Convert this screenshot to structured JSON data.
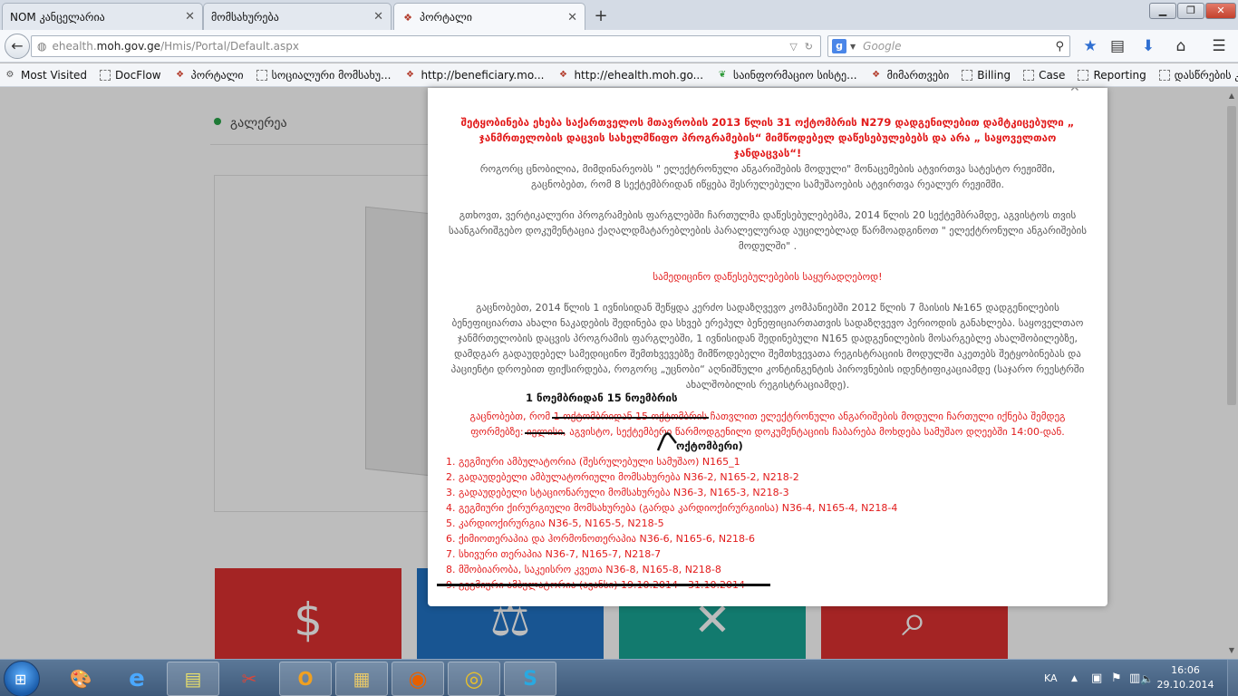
{
  "browser": {
    "tabs": [
      {
        "label": "NOM კანცელარია",
        "close": "✕"
      },
      {
        "label": "მომსახურება",
        "close": "✕"
      },
      {
        "label": "პორტალი",
        "close": "✕"
      }
    ],
    "new_tab": "+",
    "window_controls": {
      "minimize": "▁",
      "restore": "❐",
      "close": "✕"
    },
    "back_icon": "←",
    "url_prefix": "ehealth.",
    "url_domain": "moh.gov.ge",
    "url_path": "/Hmis/Portal/Default.aspx",
    "search_engine": "g",
    "search_placeholder": "Google",
    "bookmarks": [
      {
        "label": "Most Visited",
        "icon": "gear"
      },
      {
        "label": "DocFlow",
        "icon": "box"
      },
      {
        "label": "პორტალი",
        "icon": "crest"
      },
      {
        "label": "სოციალური მომსახუ...",
        "icon": "box"
      },
      {
        "label": "http://beneficiary.mo...",
        "icon": "crest"
      },
      {
        "label": "http://ehealth.moh.go...",
        "icon": "crest"
      },
      {
        "label": "საინფორმაციო სისტე...",
        "icon": "leaf"
      },
      {
        "label": "მიმართვები",
        "icon": "crest"
      },
      {
        "label": "Billing",
        "icon": "box"
      },
      {
        "label": "Case",
        "icon": "box"
      },
      {
        "label": "Reporting",
        "icon": "box"
      },
      {
        "label": "დასწრების კონტრო...",
        "icon": "box"
      }
    ]
  },
  "page": {
    "section_title": "გალერეა"
  },
  "modal": {
    "close": "✕",
    "title_line1": "შეტყობინება ეხება საქართველოს მთავრობის 2013 წლის 31 ოქტომბრის N279 დადგენილებით დამტკიცებული „",
    "title_line2": "ჯანმრთელობის დაცვის სახელმწიფო პროგრამების“ მიმწოდებელ დაწესებულებებს და არა „ საყოველთაო ჯანდაცვას“!",
    "para1": "როგორც ცნობილია, მიმდინარეობს \" ელექტრონული ანგარიშების მოდული\" მონაცემების ატვირთვა სატესტო რეჟიმში, გაცნობებთ, რომ 8 სექტემბრიდან იწყება შესრულებული სამუშაოების ატვირთვა რეალურ რეჟიმში.",
    "para2": "გთხოვთ, ვერტიკალური პროგრამების ფარგლებში ჩართულმა დაწესებულებებმა, 2014 წლის 20 სექტემბრამდე, აგვისტოს თვის საანგარიშგებო დოკუმენტაცია ქაღალდმატარებლების პარალელურად აუცილებლად წარმოადგინოთ \" ელექტრონული ანგარიშების მოდულში\" .",
    "notice": "სამედიცინო დაწესებულებების საყურადღებოდ!",
    "para3": "გაცნობებთ, 2014 წლის 1 ივნისიდან შეწყდა კერძო სადაზღვევო კომპანიებში 2012 წლის 7 მაისის №165 დადგენილების ბენეფიციართა ახალი ნაკადების შედინება და სხვებ ერეპულ ბენეფიციართათვის სადაზღვევო პერიოდის განახლება. საყოველთაო ჯანმრთელობის დაცვის პროგრამის ფარგლებში, 1 ივნისიდან შედინებული N165 დადგენილების მოსარგებლე ახალშობილებზე, დამდგარ გადაუდებელ სამედიცინო შემთხვევებზე მიმწოდებელი შემთხვევათა რეგისტრაციის მოდულში აკეთებს შეტყობინებას და პაციენტი დროებით ფიქსირდება, როგორც „უცნობი“ აღნიშნული კონტინგენტის პიროვნების იდენტიფიკაციამდე (საჯარო რეესტრში ახალშობილის რეგისტრაციამდე).",
    "handwritten_top": "1 ნოემბრიდან 15 ნოემბრის",
    "red_part1": "გაცნობებთ, რომ ",
    "red_struck1": "1 ოქტომბრიდან 15 ოქტომბრის",
    "red_part2": " ჩათვლით ელექტრონული ანგარიშების მოდული ჩართული იქნება შემდეგ ფორმებზე: ",
    "red_struck2": "ივლისი",
    "red_part3": ", აგვისტო, სექტემბერი წარმოდგენილი დოკუმენტაციის ჩაბარება მოხდება სამუშაო დღეებში 14:00-დან.",
    "handwritten_bottom": "ოქტომბერი)",
    "list": [
      "1. გეგმიური ამბულატორია (შესრულებული სამუშაო) N165_1",
      "2. გადაუდებელი ამბულატორიული მომსახურება N36-2, N165-2, N218-2",
      "3. გადაუდებელი სტაციონარული მომსახურება N36-3, N165-3, N218-3",
      "4. გეგმიური ქირურგიული მომსახურება (გარდა კარდიოქირურგიისა) N36-4, N165-4, N218-4",
      "5. კარდიოქირურგია N36-5, N165-5, N218-5",
      "6. ქიმიოთერაპია და ჰორმონოთერაპია N36-6, N165-6, N218-6",
      "7. სხივური თერაპია N36-7, N165-7, N218-7",
      "8. მშობიარობა, საკეისრო კვეთა N36-8, N165-8, N218-8",
      "9. გეგმიური ამბულატორია (ავანსი) 19.10.2014 - 31.10.2014"
    ]
  },
  "taskbar": {
    "start_icon": "⊞",
    "apps": [
      {
        "name": "paint",
        "icon": "🎨"
      },
      {
        "name": "internet-explorer",
        "icon": "e"
      },
      {
        "name": "sticky-notes",
        "icon": "▤"
      },
      {
        "name": "snipping-tool",
        "icon": "✂"
      },
      {
        "name": "outlook",
        "icon": "O"
      },
      {
        "name": "explorer",
        "icon": "▦"
      },
      {
        "name": "firefox",
        "icon": "◉"
      },
      {
        "name": "chrome",
        "icon": "◎"
      },
      {
        "name": "skype",
        "icon": "S"
      }
    ],
    "language": "KA",
    "time": "16:06",
    "date": "29.10.2014"
  },
  "colors": {
    "modal_red": "#e21b1b",
    "tile_red": "#d32f2f",
    "tile_blue": "#1976d2",
    "tile_teal": "#00897b",
    "firefox_orange": "#e66000"
  }
}
